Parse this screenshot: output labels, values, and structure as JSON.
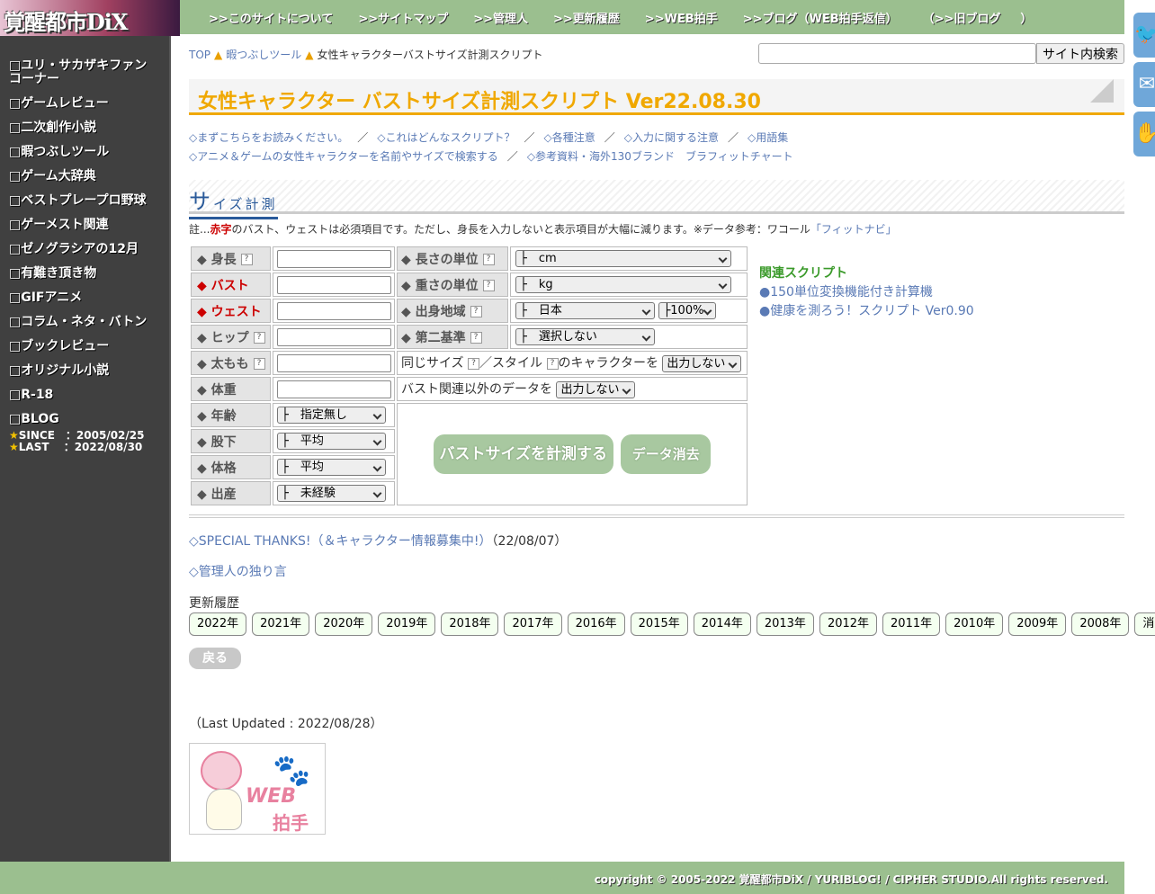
{
  "site": {
    "logo": "覚醒都市DiX"
  },
  "topnav": {
    "items": [
      ">>このサイトについて",
      ">>サイトマップ",
      ">>管理人",
      ">>更新履歴",
      ">>WEB拍手",
      ">>ブログ（WEB拍手返信）"
    ],
    "old_open": "（",
    ">>old": "",
    "old": ">>旧ブログ",
    "old_close": "）"
  },
  "sidebar": {
    "items": [
      "□ユリ・サカザキファンコーナー",
      "□ゲームレビュー",
      "□二次創作小説",
      "□暇つぶしツール",
      "□ゲーム大辞典",
      "□ベストプレープロ野球",
      "□ゲーメスト関連",
      "□ゼノグラシアの12月",
      "□有難き頂き物",
      "□GIFアニメ",
      "□コラム・ネタ・バトン",
      "□ブックレビュー",
      "□オリジナル小説",
      "□R-18",
      "□BLOG"
    ],
    "since_label": "SINCE　：2005/02/25",
    "last_label": "LAST　 ：2022/08/30",
    "star": "★"
  },
  "breadcrumb": {
    "top": "TOP",
    "tri": "▲",
    "tools": "暇つぶしツール",
    "current": "女性キャラクターバストサイズ計測スクリプト"
  },
  "search": {
    "placeholder": "",
    "button": "サイト内検索"
  },
  "title": "女性キャラクター バストサイズ計測スクリプト Ver22.08.30",
  "links": {
    "row1": [
      "◇まずこちらをお読みください。",
      "◇これはどんなスクリプト？",
      "◇各種注意",
      "◇入力に関する注意",
      "◇用語集"
    ],
    "row2": [
      "◇アニメ＆ゲームの女性キャラクターを名前やサイズで検索する",
      "◇参考資料・海外130ブランド　ブラフィットチャート"
    ],
    "sep": "／"
  },
  "section": {
    "big": "サ",
    "rest": "イズ計測"
  },
  "note": {
    "pre": "註...",
    "red": "赤字",
    "mid": "のバスト、ウェストは必須項目です。ただし、身長を入力しないと表示項目が大幅に減ります。※データ参考：ワコール",
    "link": "「フィットナビ」"
  },
  "form": {
    "height": "◆ 身長",
    "bust": "◆ バスト",
    "waist": "◆ ウェスト",
    "hip": "◆ ヒップ",
    "thigh": "◆ 太もも",
    "weight": "◆ 体重",
    "age": "◆ 年齢",
    "inseam": "◆ 股下",
    "build": "◆ 体格",
    "birth": "◆ 出産",
    "len_unit": "◆ 長さの単位",
    "wt_unit": "◆ 重さの単位",
    "origin": "◆ 出身地域",
    "second": "◆ 第二基準",
    "len_val": "├　cm",
    "wt_val": "├　kg",
    "origin_val": "├　日本",
    "pct_val": "├100%",
    "second_val": "├　選択しない",
    "age_val": "├　指定無し",
    "inseam_val": "├　平均",
    "build_val": "├　平均",
    "birth_val": "├　未経験",
    "same_pre": "同じサイズ",
    "same_mid": "／スタイル",
    "same_post": "のキャラクターを",
    "same_val": "出力しない",
    "other_pre": "バスト関連以外のデータを",
    "other_val": "出力しない",
    "q": "?",
    "measure": "バストサイズを計測する",
    "clear": "データ消去"
  },
  "related": {
    "head": "関連スクリプト",
    "items": [
      "●150単位変換機能付き計算機",
      "●健康を測ろう！スクリプト Ver0.90"
    ]
  },
  "thanks": {
    "link": "◇SPECIAL THANKS!（＆キャラクター情報募集中!）",
    "date": "（22/08/07）"
  },
  "monologue": "◇管理人の独り言",
  "update_history": {
    "label": "更新履歴",
    "years": [
      "2022年",
      "2021年",
      "2020年",
      "2019年",
      "2018年",
      "2017年",
      "2016年",
      "2015年",
      "2014年",
      "2013年",
      "2012年",
      "2011年",
      "2010年",
      "2009年",
      "2008年",
      "消去"
    ]
  },
  "back": "戻る",
  "last_updated": "（Last Updated : 2022/08/28）",
  "clap": {
    "web": "WEB",
    "hakushu": "拍手"
  },
  "footer": "copyright © 2005-2022 覚醒都市DiX / YURIBLOG! / CIPHER STUDIO.All rights reserved.",
  "icons": [
    "twitter-icon",
    "mail-icon",
    "clap-hand-icon"
  ]
}
